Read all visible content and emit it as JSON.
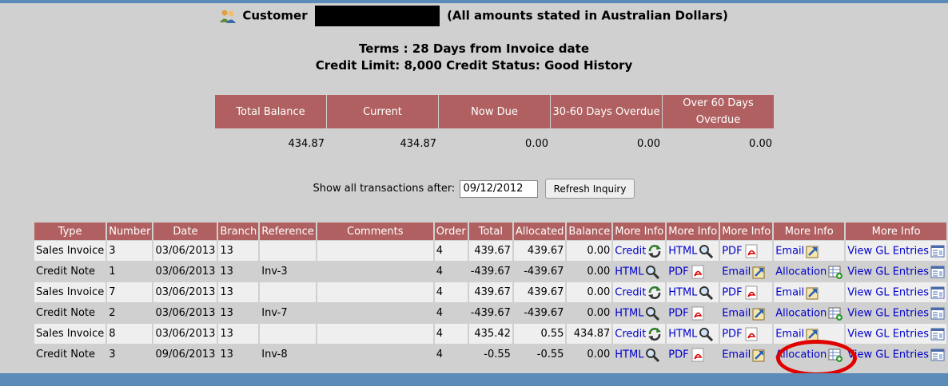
{
  "header": {
    "customer_label": "Customer",
    "currency_note": "(All amounts stated in Australian Dollars)",
    "terms": "Terms : 28 Days from Invoice date",
    "credit": "Credit Limit: 8,000 Credit Status: Good History"
  },
  "aging": {
    "headers": [
      "Total Balance",
      "Current",
      "Now Due",
      "30-60 Days Overdue",
      "Over 60 Days Overdue"
    ],
    "values": [
      "434.87",
      "434.87",
      "0.00",
      "0.00",
      "0.00"
    ]
  },
  "filter": {
    "label": "Show all transactions after:",
    "date_value": "09/12/2012",
    "button_label": "Refresh Inquiry"
  },
  "table": {
    "headers": [
      "Type",
      "Number",
      "Date",
      "Branch",
      "Reference",
      "Comments",
      "Order",
      "Total",
      "Allocated",
      "Balance",
      "More Info",
      "More Info",
      "More Info",
      "More Info",
      "More Info"
    ],
    "rows": [
      {
        "type": "Sales Invoice",
        "number": "3",
        "date": "03/06/2013",
        "branch": "13",
        "reference": "",
        "comments": "",
        "order": "4",
        "total": "439.67",
        "allocated": "439.67",
        "balance": "0.00",
        "a1": "Credit",
        "a2": "HTML",
        "a3": "PDF",
        "a4": "Email",
        "a5": "View GL Entries"
      },
      {
        "type": "Credit Note",
        "number": "1",
        "date": "03/06/2013",
        "branch": "13",
        "reference": "Inv-3",
        "comments": "",
        "order": "4",
        "total": "-439.67",
        "allocated": "-439.67",
        "balance": "0.00",
        "a1": "HTML",
        "a2": "PDF",
        "a3": "Email",
        "a4": "Allocation",
        "a5": "View GL Entries"
      },
      {
        "type": "Sales Invoice",
        "number": "7",
        "date": "03/06/2013",
        "branch": "13",
        "reference": "",
        "comments": "",
        "order": "4",
        "total": "439.67",
        "allocated": "439.67",
        "balance": "0.00",
        "a1": "Credit",
        "a2": "HTML",
        "a3": "PDF",
        "a4": "Email",
        "a5": "View GL Entries"
      },
      {
        "type": "Credit Note",
        "number": "2",
        "date": "03/06/2013",
        "branch": "13",
        "reference": "Inv-7",
        "comments": "",
        "order": "4",
        "total": "-439.67",
        "allocated": "-439.67",
        "balance": "0.00",
        "a1": "HTML",
        "a2": "PDF",
        "a3": "Email",
        "a4": "Allocation",
        "a5": "View GL Entries"
      },
      {
        "type": "Sales Invoice",
        "number": "8",
        "date": "03/06/2013",
        "branch": "13",
        "reference": "",
        "comments": "",
        "order": "4",
        "total": "435.42",
        "allocated": "0.55",
        "balance": "434.87",
        "a1": "Credit",
        "a2": "HTML",
        "a3": "PDF",
        "a4": "Email",
        "a5": "View GL Entries"
      },
      {
        "type": "Credit Note",
        "number": "3",
        "date": "09/06/2013",
        "branch": "13",
        "reference": "Inv-8",
        "comments": "",
        "order": "4",
        "total": "-0.55",
        "allocated": "-0.55",
        "balance": "0.00",
        "a1": "HTML",
        "a2": "PDF",
        "a3": "Email",
        "a4": "Allocation",
        "a5": "View GL Entries"
      }
    ]
  },
  "icons": {
    "Credit": "credit-refresh-icon",
    "HTML": "magnifier-icon",
    "PDF": "pdf-icon",
    "Email": "email-upload-icon",
    "Allocation": "allocation-icon",
    "View GL Entries": "gl-entries-icon"
  },
  "colors": {
    "header_bg": "#b06060",
    "page_bg": "#d0d0d0",
    "link": "#0000cc",
    "bar": "#5b8bb8",
    "highlight": "#e00000"
  }
}
